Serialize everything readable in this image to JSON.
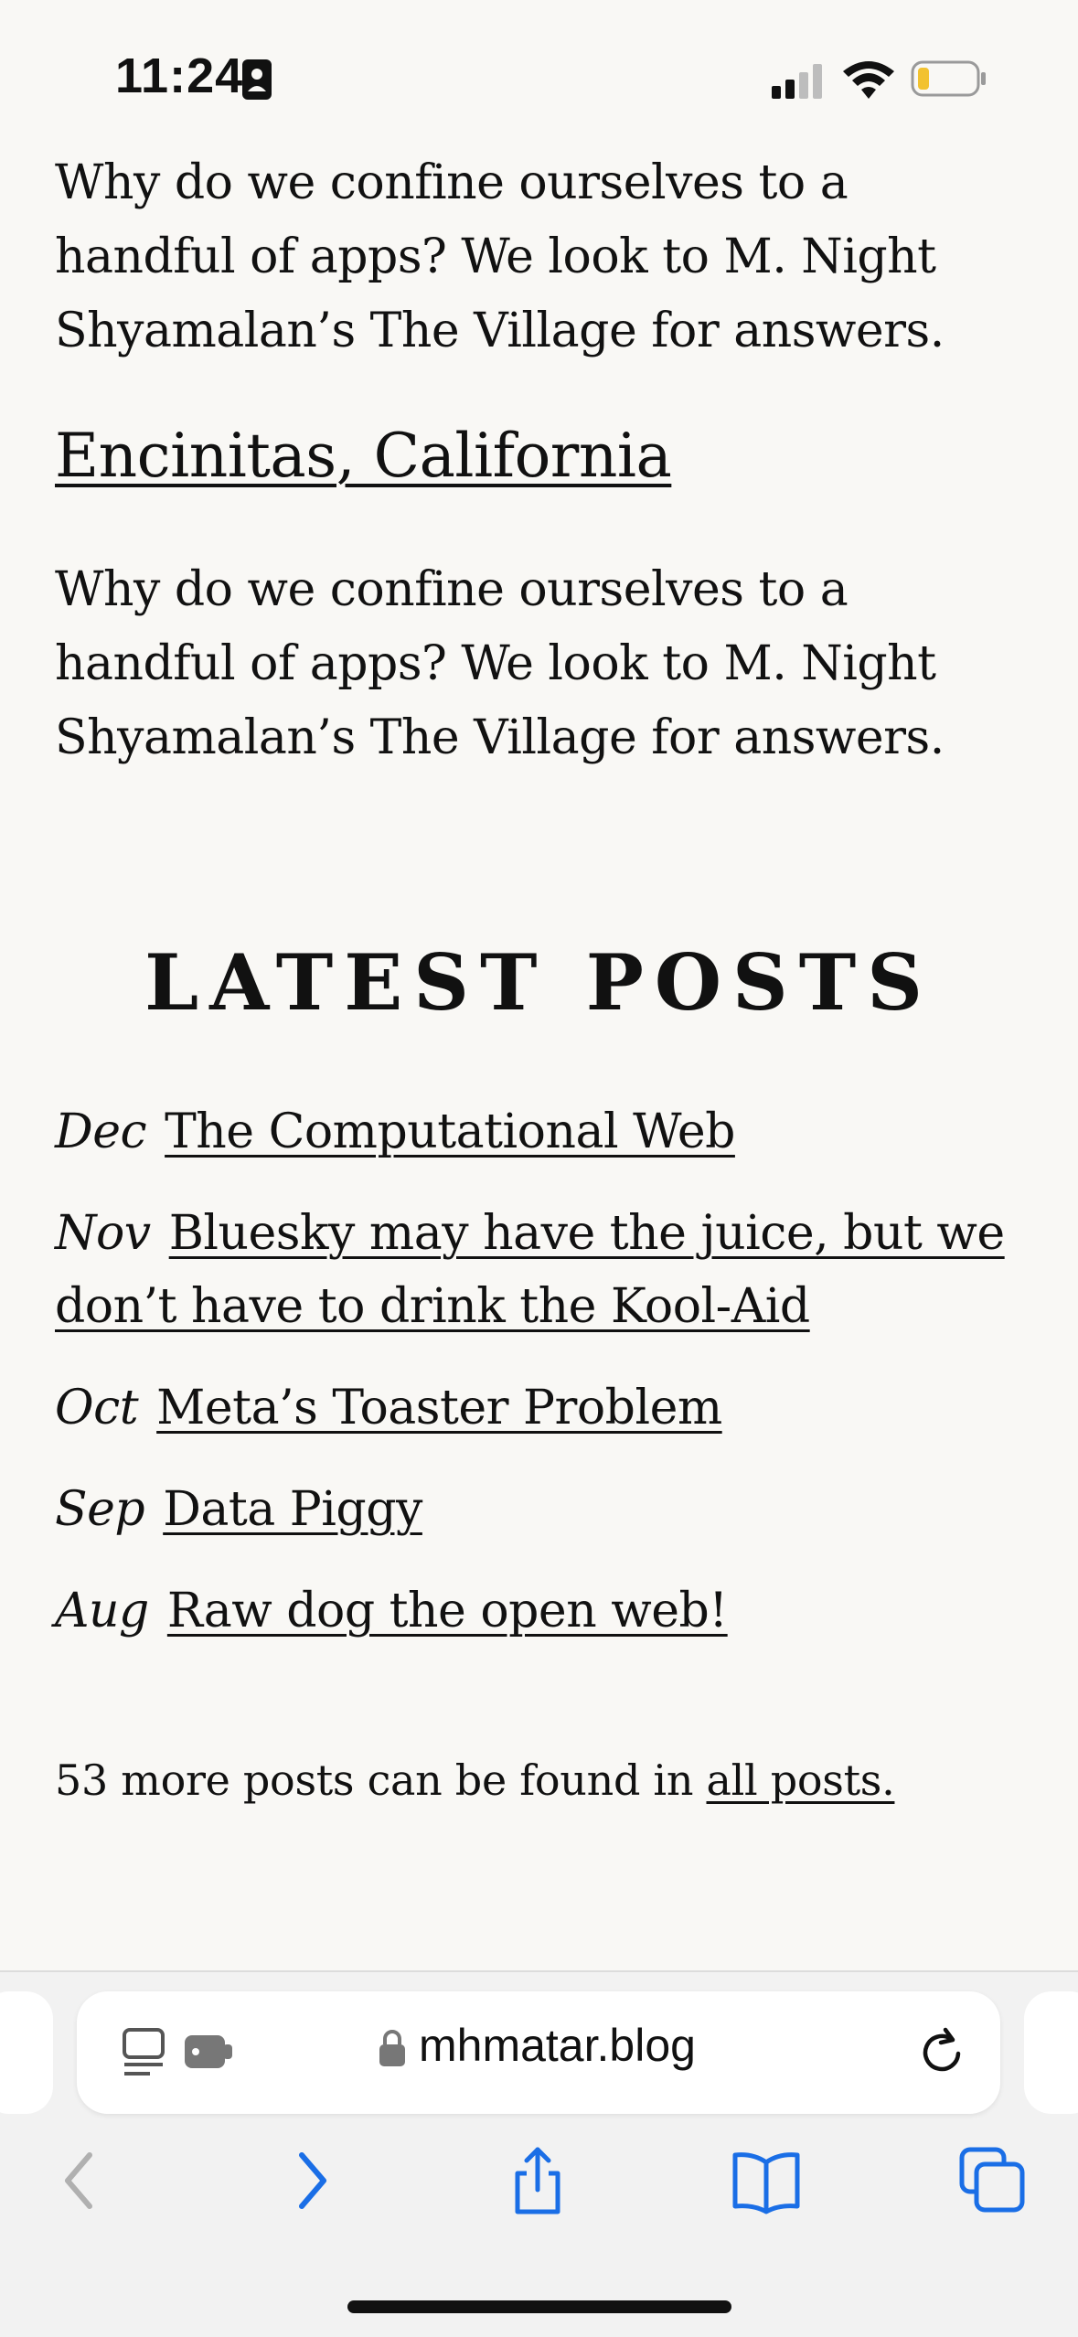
{
  "status_bar": {
    "time": "11:24",
    "icons": [
      "id-card-icon",
      "signal-icon",
      "wifi-icon",
      "battery-icon"
    ]
  },
  "content": {
    "para1": "Why do we confine ourselves to a handful of apps? We look to M. Night Shyamalan’s The Village for answers.",
    "place": "Encinitas, California",
    "para2": "Why do we confine ourselves to a handful of apps? We look to M. Night Shyamalan’s The Village for answers."
  },
  "latest": {
    "heading": "LATEST POSTS",
    "posts": [
      {
        "month": "Dec",
        "title": "The Computational Web"
      },
      {
        "month": "Nov",
        "title": "Bluesky may have the juice, but we don’t have to drink the Kool-Aid"
      },
      {
        "month": "Oct",
        "title": "Meta’s Toaster Problem"
      },
      {
        "month": "Sep",
        "title": "Data Piggy"
      },
      {
        "month": "Aug",
        "title": "Raw dog the open web!"
      }
    ]
  },
  "more": {
    "text": "53 more posts can be found in ",
    "link": "all posts."
  },
  "browser": {
    "url": "mhmatar.blog",
    "icons": [
      "reader-icon",
      "lock-icon",
      "reload-icon",
      "back-icon",
      "forward-icon",
      "share-icon",
      "bookmarks-icon",
      "tabs-icon"
    ]
  },
  "colors": {
    "background": "#f9f8f5",
    "text": "#111111",
    "link_blue": "#1a6ee6",
    "disabled_gray": "#b0b0b0"
  }
}
